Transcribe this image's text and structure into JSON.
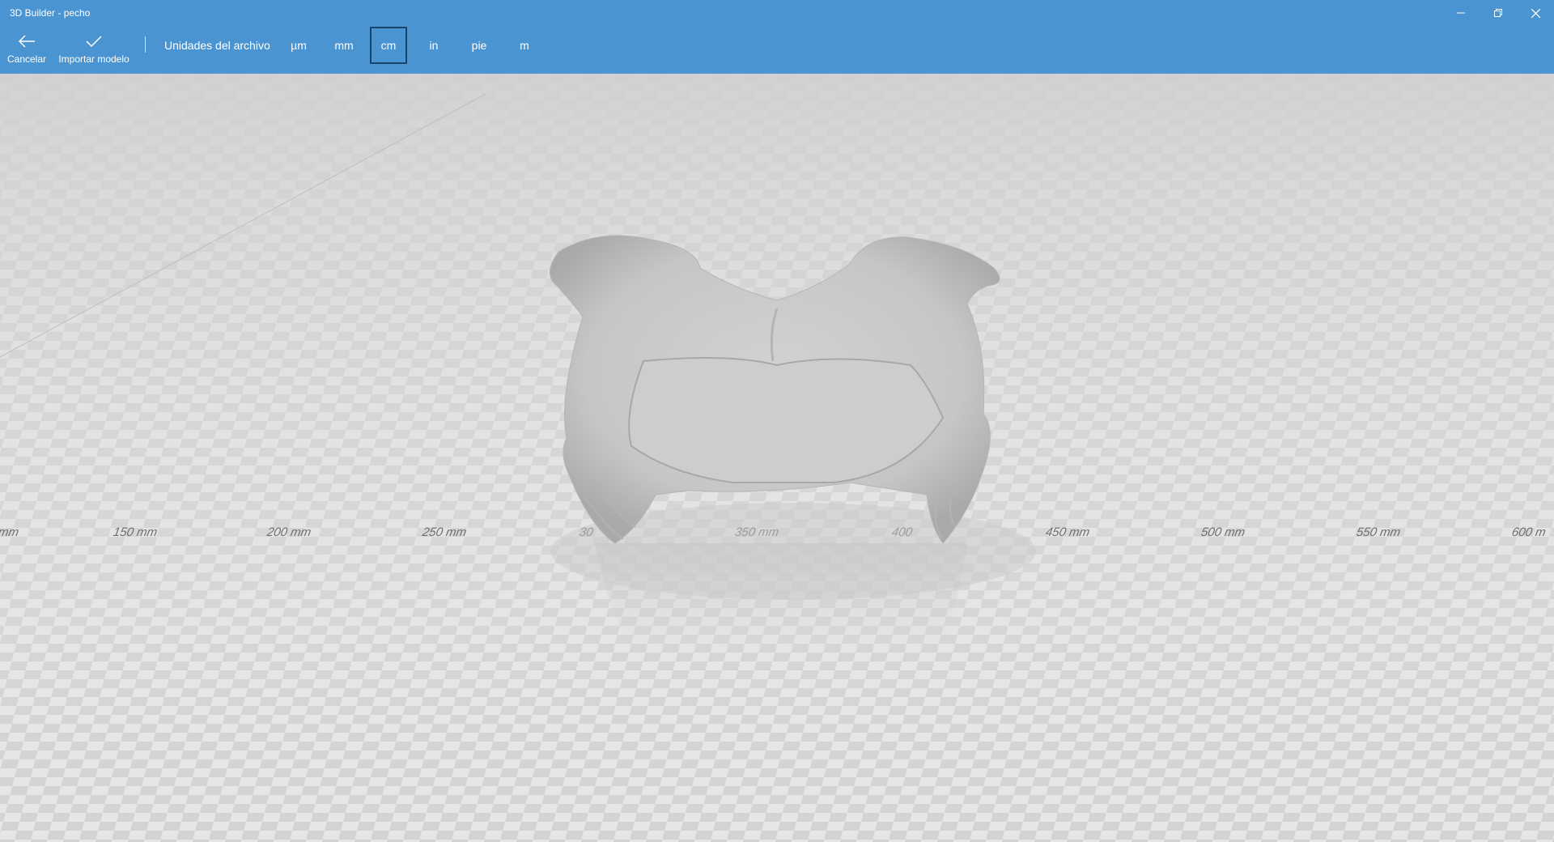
{
  "window": {
    "title": "3D Builder - pecho",
    "controls": {
      "minimize": "minimize-icon",
      "restore": "restore-icon",
      "close": "close-icon"
    }
  },
  "toolbar": {
    "cancel_label": "Cancelar",
    "import_label": "Importar modelo",
    "units_label": "Unidades del archivo",
    "units": [
      "µm",
      "mm",
      "cm",
      "in",
      "pie",
      "m"
    ],
    "selected_unit": "cm"
  },
  "viewport": {
    "ruler_labels": [
      "mm",
      "150 mm",
      "200 mm",
      "250 mm",
      "30",
      "350 mm",
      "400",
      "450 mm",
      "500 mm",
      "550 mm",
      "600 m"
    ],
    "colors": {
      "toolbar": "#4a94d1",
      "selected_border": "#17456c",
      "floor": "#e4e4e4"
    }
  }
}
